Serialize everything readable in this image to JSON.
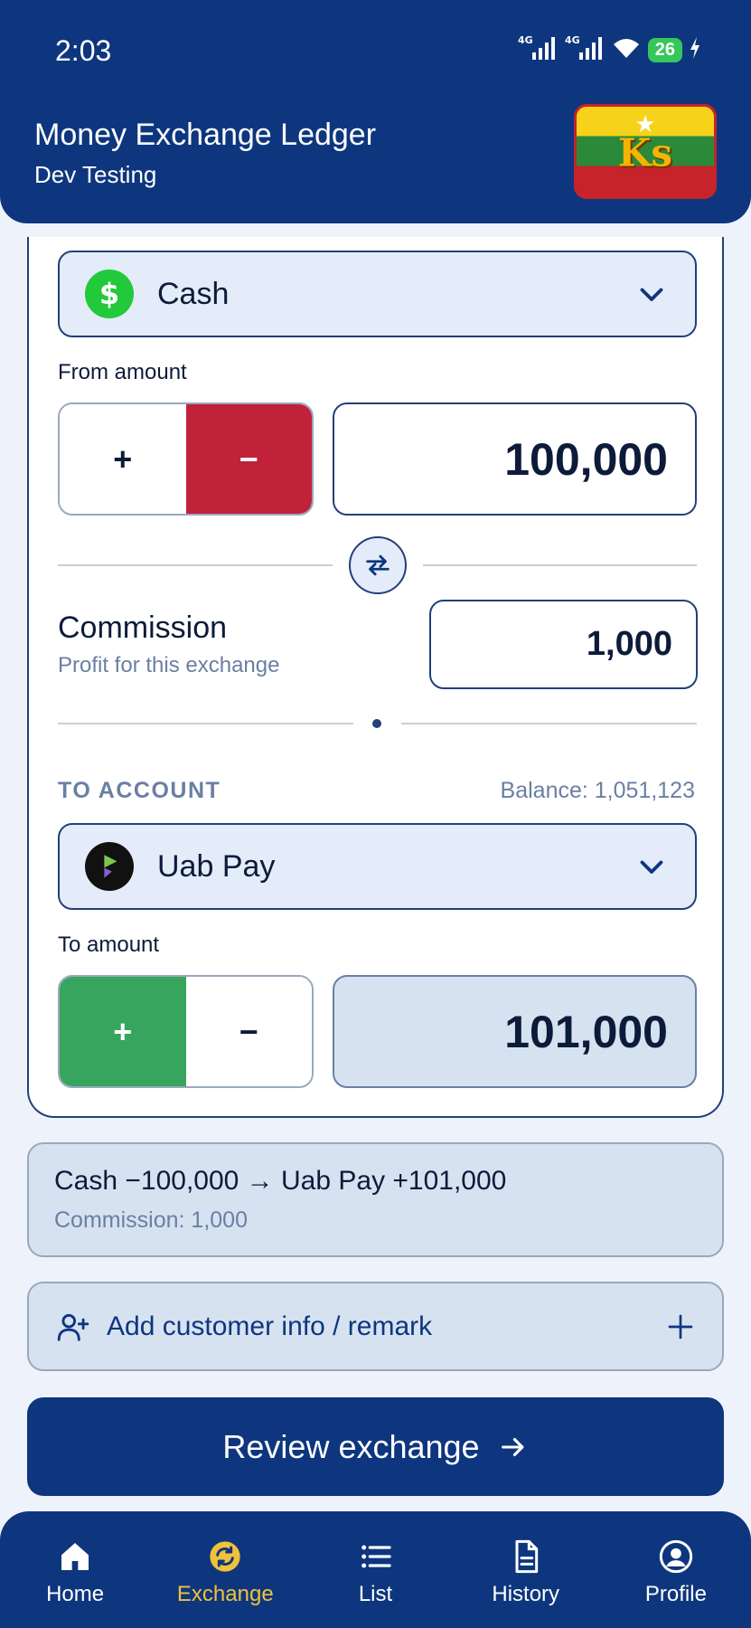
{
  "status_bar": {
    "time": "2:03",
    "signal_1": "4G",
    "signal_2": "4G",
    "battery": "26"
  },
  "header": {
    "title": "Money Exchange Ledger",
    "subtitle": "Dev Testing",
    "logo_text": "Ks"
  },
  "from": {
    "account": "Cash",
    "amount_label": "From amount",
    "plus": "+",
    "minus": "−",
    "amount": "100,000"
  },
  "commission": {
    "title": "Commission",
    "subtitle": "Profit for this exchange",
    "amount": "1,000"
  },
  "to": {
    "section_label": "TO ACCOUNT",
    "balance": "Balance: 1,051,123",
    "account": "Uab Pay",
    "amount_label": "To amount",
    "plus": "+",
    "minus": "−",
    "amount": "101,000"
  },
  "summary": {
    "main": "Cash −100,000 → Uab Pay +101,000",
    "sub": "Commission: 1,000"
  },
  "remark": {
    "label": "Add customer info / remark"
  },
  "review": {
    "label": "Review exchange"
  },
  "nav": [
    {
      "label": "Home",
      "icon": "home-icon"
    },
    {
      "label": "Exchange",
      "icon": "exchange-icon",
      "active": true
    },
    {
      "label": "List",
      "icon": "list-icon"
    },
    {
      "label": "History",
      "icon": "document-icon"
    },
    {
      "label": "Profile",
      "icon": "profile-icon"
    }
  ],
  "colors": {
    "primary": "#0e367e",
    "minus_active": "#c0223a",
    "plus_active": "#37a55d",
    "nav_active": "#f0c23a",
    "cash_icon": "#22c93a"
  }
}
